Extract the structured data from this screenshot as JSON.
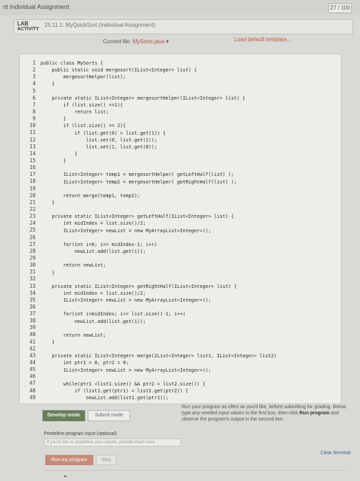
{
  "header": {
    "title": "nt Individual Assignment",
    "score": "27 / 100"
  },
  "activity": {
    "lab_label": "LAB",
    "activity_label": "ACTIVITY",
    "breadcrumb": "25.11.1: MyQuickSort (Individual Assignment)"
  },
  "file": {
    "label": "Current file:",
    "name": "MySorts.java",
    "caret": "▾",
    "load_template": "Load default template..."
  },
  "editor": {
    "line_numbers": [
      "1",
      "2",
      "3",
      "4",
      "5",
      "6",
      "7",
      "8",
      "9",
      "10",
      "11",
      "12",
      "13",
      "14",
      "15",
      "16",
      "17",
      "18",
      "19",
      "20",
      "21",
      "22",
      "23",
      "24",
      "25",
      "26",
      "27",
      "28",
      "29",
      "30",
      "31",
      "32",
      "33",
      "34",
      "35",
      "36",
      "37",
      "38",
      "39",
      "40",
      "41",
      "42",
      "43",
      "44",
      "45",
      "46",
      "47",
      "48",
      "49"
    ],
    "lines": [
      {
        "n": "1",
        "text": "public class MySorts {"
      },
      {
        "n": "2",
        "text": "    public static void mergesort(IList<Integer> list) {"
      },
      {
        "n": "3",
        "text": "        mergesortHelper(list);"
      },
      {
        "n": "4",
        "text": "    }"
      },
      {
        "n": "5",
        "text": ""
      },
      {
        "n": "6",
        "text": "    private static IList<Integer> mergesortHelper(IList<Integer> list) {"
      },
      {
        "n": "7",
        "text": "        if (list.size() <=1){"
      },
      {
        "n": "8",
        "text": "            return list;"
      },
      {
        "n": "9",
        "text": "        }"
      },
      {
        "n": "10",
        "text": "        if (list.size() == 2){"
      },
      {
        "n": "11",
        "text": "            if (list.get(0) > list.get(1)) {"
      },
      {
        "n": "12",
        "text": "                list.set(0, list.get(1));"
      },
      {
        "n": "13",
        "text": "                list.set(1, list.get(0));"
      },
      {
        "n": "14",
        "text": "            }"
      },
      {
        "n": "15",
        "text": "        }"
      },
      {
        "n": "16",
        "text": ""
      },
      {
        "n": "17",
        "text": "        IList<Integer> temp1 = mergesortHelper( getLeftHalf(list) );"
      },
      {
        "n": "18",
        "text": "        IList<Integer> temp2 = mergesortHelper( getRightHalf(list) );"
      },
      {
        "n": "19",
        "text": ""
      },
      {
        "n": "20",
        "text": "        return merge(temp1, temp2);"
      },
      {
        "n": "21",
        "text": "    }"
      },
      {
        "n": "22",
        "text": ""
      },
      {
        "n": "23",
        "text": "    private static IList<Integer> getLeftHalf(IList<Integer> list) {"
      },
      {
        "n": "24",
        "text": "        int midIndex = list.size()/2;"
      },
      {
        "n": "25",
        "text": "        IList<Integer> newList = new MyArrayList<Integer>();"
      },
      {
        "n": "26",
        "text": ""
      },
      {
        "n": "27",
        "text": "        for(int i=0; i<= midIndex-1; i++)"
      },
      {
        "n": "28",
        "text": "            newList.add(list.get(i));"
      },
      {
        "n": "29",
        "text": ""
      },
      {
        "n": "30",
        "text": "        return newList;"
      },
      {
        "n": "31",
        "text": "    }"
      },
      {
        "n": "32",
        "text": ""
      },
      {
        "n": "33",
        "text": "    private static IList<Integer> getRightHalf(IList<Integer> list) {"
      },
      {
        "n": "34",
        "text": "        int midIndex = list.size()/2;"
      },
      {
        "n": "35",
        "text": "        IList<Integer> newList = new MyArrayList<Integer>();"
      },
      {
        "n": "36",
        "text": ""
      },
      {
        "n": "37",
        "text": "        for(int i=midIndex; i<= list.size()-1; i++)"
      },
      {
        "n": "38",
        "text": "            newList.add(list.get(i));"
      },
      {
        "n": "39",
        "text": ""
      },
      {
        "n": "40",
        "text": "        return newList;"
      },
      {
        "n": "41",
        "text": "    }"
      },
      {
        "n": "42",
        "text": ""
      },
      {
        "n": "43",
        "text": "    private static IList<Integer> merge(IList<Integer> list1, IList<Integer> list2)"
      },
      {
        "n": "44",
        "text": "        int ptr1 = 0, ptr2 = 0;"
      },
      {
        "n": "45",
        "text": "        IList<Integer> newList = new MyArrayList<Integer>();"
      },
      {
        "n": "46",
        "text": ""
      },
      {
        "n": "47",
        "text": "        while(ptr1 <list1.size() && ptr2 < list2.size()) {"
      },
      {
        "n": "48",
        "text": "            if (list1.get(ptr1) < list2.get(ptr2)) {"
      },
      {
        "n": "49",
        "text": "                newList.add(list1.get(ptr1));"
      }
    ]
  },
  "controls": {
    "develop_mode": "Develop mode",
    "submit_mode": "Submit mode"
  },
  "help": {
    "text_before": "Run your program as often as you'd like, before submitting for grading. Below, type any needed input values in the first box, then click ",
    "run_bold": "Run program",
    "text_after": " and observe the program's output in the second box."
  },
  "input": {
    "label": "Predefine program input (optional)",
    "placeholder": "If you'd like to predefine your inputs, provide them here"
  },
  "run": {
    "run_label": "Run my program",
    "step_label": "Step",
    "clear_label": "Clear terminal"
  },
  "terminal": {
    "prompt": "▸"
  }
}
